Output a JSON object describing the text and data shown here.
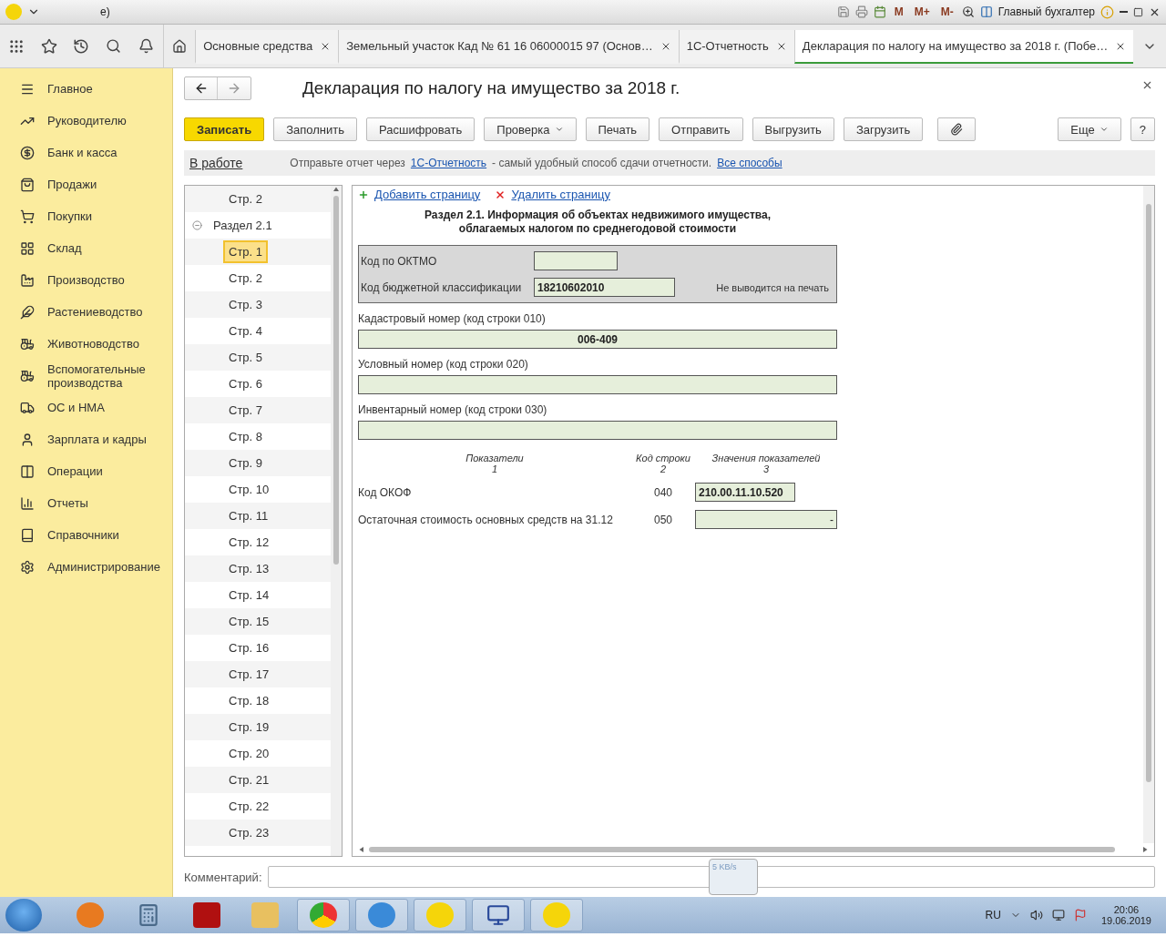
{
  "window": {
    "title": "е)",
    "user": "Главный бухгалтер",
    "memory_buttons": [
      "M",
      "M+",
      "M-"
    ]
  },
  "tabs": [
    {
      "label": "Основные средства",
      "selected": false
    },
    {
      "label": "Земельный участок Кад № 61 16 06000015 97 (Основ…",
      "selected": false
    },
    {
      "label": "1С-Отчетность",
      "selected": false
    },
    {
      "label": "Декларация по налогу на имущество за 2018 г. (Побе…",
      "selected": true
    }
  ],
  "sidebar": {
    "items": [
      {
        "label": "Главное"
      },
      {
        "label": "Руководителю"
      },
      {
        "label": "Банк и касса"
      },
      {
        "label": "Продажи"
      },
      {
        "label": "Покупки"
      },
      {
        "label": "Склад"
      },
      {
        "label": "Производство"
      },
      {
        "label": "Растениеводство"
      },
      {
        "label": "Животноводство"
      },
      {
        "label": "Вспомогательные производства"
      },
      {
        "label": "ОС и НМА"
      },
      {
        "label": "Зарплата и кадры"
      },
      {
        "label": "Операции"
      },
      {
        "label": "Отчеты"
      },
      {
        "label": "Справочники"
      },
      {
        "label": "Администрирование"
      }
    ]
  },
  "document": {
    "title": "Декларация по налогу на имущество за 2018 г.",
    "toolbar": [
      {
        "label": "Записать",
        "kind": "primary"
      },
      {
        "label": "Заполнить",
        "kind": "plain"
      },
      {
        "label": "Расшифровать",
        "kind": "plain"
      },
      {
        "label": "Проверка",
        "kind": "menu"
      },
      {
        "label": "Печать",
        "kind": "plain"
      },
      {
        "label": "Отправить",
        "kind": "plain"
      },
      {
        "label": "Выгрузить",
        "kind": "plain"
      },
      {
        "label": "Загрузить",
        "kind": "plain"
      },
      {
        "kind": "attach"
      }
    ],
    "more_button": "Еще",
    "help_button": "?",
    "status_link": "В работе",
    "notice": {
      "before": "Отправьте отчет через",
      "link": "1С-Отчетность",
      "after": "- самый удобный способ сдачи отчетности.",
      "link2": "Все способы"
    }
  },
  "tree": [
    {
      "label": "Стр. 2",
      "selected": false
    },
    {
      "label": "Раздел 2.1",
      "expanded": true,
      "selected": false,
      "children": [
        {
          "label": "Стр. 1",
          "selected": true
        },
        {
          "label": "Стр. 2",
          "selected": false
        },
        {
          "label": "Стр. 3",
          "selected": false
        },
        {
          "label": "Стр. 4",
          "selected": false
        },
        {
          "label": "Стр. 5",
          "selected": false
        },
        {
          "label": "Стр. 6",
          "selected": false
        },
        {
          "label": "Стр. 7",
          "selected": false
        },
        {
          "label": "Стр. 8",
          "selected": false
        },
        {
          "label": "Стр. 9",
          "selected": false
        },
        {
          "label": "Стр. 10",
          "selected": false
        },
        {
          "label": "Стр. 11",
          "selected": false
        },
        {
          "label": "Стр. 12",
          "selected": false
        },
        {
          "label": "Стр. 13",
          "selected": false
        },
        {
          "label": "Стр. 14",
          "selected": false
        },
        {
          "label": "Стр. 15",
          "selected": false
        },
        {
          "label": "Стр. 16",
          "selected": false
        },
        {
          "label": "Стр. 17",
          "selected": false
        },
        {
          "label": "Стр. 18",
          "selected": false
        },
        {
          "label": "Стр. 19",
          "selected": false
        },
        {
          "label": "Стр. 20",
          "selected": false
        },
        {
          "label": "Стр. 21",
          "selected": false
        },
        {
          "label": "Стр. 22",
          "selected": false
        },
        {
          "label": "Стр. 23",
          "selected": false
        }
      ]
    }
  ],
  "form": {
    "add_page": "Добавить страницу",
    "delete_page": "Удалить страницу",
    "heading": "Раздел 2.1. Информация об объектах недвижимого имущества,\nоблагаемых налогом по среднегодовой стоимости",
    "oktmo_label": "Код по ОКТМО",
    "kbk_label": "Код бюджетной классификации",
    "kbk_value": "18210602010",
    "no_print_note": "Не выводится на печать",
    "fields": [
      {
        "label": "Кадастровый номер (код строки 010)",
        "value": "006-409"
      },
      {
        "label": "Условный номер (код строки 020)"
      },
      {
        "label": "Инвентарный номер (код строки 030)"
      }
    ],
    "columns": [
      {
        "title": "Показатели",
        "number": "1"
      },
      {
        "title": "Код строки",
        "number": "2"
      },
      {
        "title": "Значения показателей",
        "number": "3"
      }
    ],
    "rows": [
      {
        "name": "Код ОКОФ",
        "code": "040",
        "value": "210.00.11.10.520",
        "kind": "short"
      },
      {
        "name": "Остаточная стоимость основных средств на 31.12",
        "code": "050",
        "value": "-",
        "kind": "wide"
      }
    ]
  },
  "comment_label": "Комментарий:",
  "net_widget": "5 KB/s",
  "taskbar": {
    "language": "RU",
    "time": "20:06",
    "date": "19.06.2019"
  }
}
